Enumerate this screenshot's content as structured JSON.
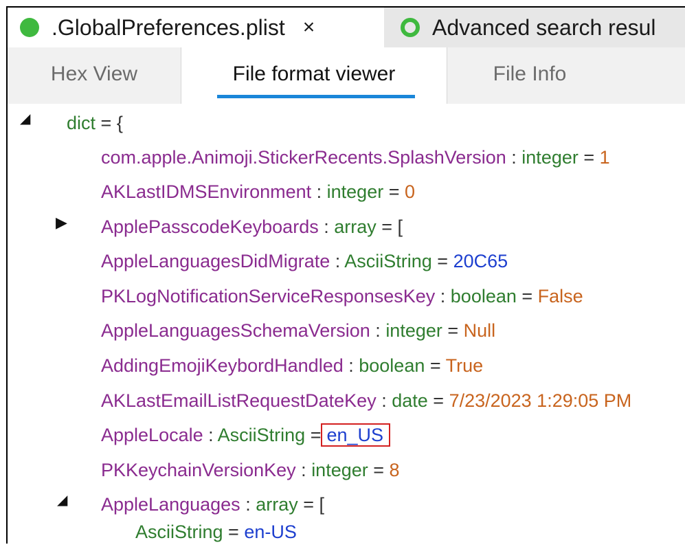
{
  "file_tabs": [
    {
      "label": ".GlobalPreferences.plist",
      "close": "×",
      "active": true
    },
    {
      "label": "Advanced search resul",
      "active": false
    }
  ],
  "view_tabs": [
    "Hex View",
    "File format viewer",
    "File Info"
  ],
  "tree": {
    "root": {
      "expander": "◢",
      "label": "dict",
      "eq": " = ",
      "open": "{"
    },
    "entries": [
      {
        "key": "com.apple.Animoji.StickerRecents.SplashVersion",
        "type": "integer",
        "value": "1",
        "vclass": "num"
      },
      {
        "key": "AKLastIDMSEnvironment",
        "type": "integer",
        "value": "0",
        "vclass": "num"
      },
      {
        "key": "ApplePasscodeKeyboards",
        "type": "array",
        "value": "[",
        "vclass": "kw",
        "expander": "▶"
      },
      {
        "key": "AppleLanguagesDidMigrate",
        "type": "AsciiString",
        "value": "20C65",
        "vclass": "str"
      },
      {
        "key": "PKLogNotificationServiceResponsesKey",
        "type": "boolean",
        "value": "False",
        "vclass": "lit"
      },
      {
        "key": "AppleLanguagesSchemaVersion",
        "type": "integer",
        "value": "Null",
        "vclass": "lit"
      },
      {
        "key": "AddingEmojiKeybordHandled",
        "type": "boolean",
        "value": "True",
        "vclass": "lit"
      },
      {
        "key": "AKLastEmailListRequestDateKey",
        "type": "date",
        "value": "7/23/2023 1:29:05 PM",
        "vclass": "lit"
      },
      {
        "key": "AppleLocale",
        "type": "AsciiString",
        "value": "en_US",
        "vclass": "str",
        "highlighted": true
      },
      {
        "key": "PKKeychainVersionKey",
        "type": "integer",
        "value": "8",
        "vclass": "num"
      },
      {
        "key": "AppleLanguages",
        "type": "array",
        "value": "[",
        "vclass": "kw",
        "expander": "◢"
      }
    ],
    "child": {
      "type": "AsciiString",
      "value": "en-US"
    }
  },
  "colors": {
    "tab_indicator": "#1a86d9",
    "status_dot": "#3fb93f",
    "highlight_border": "#d32020"
  }
}
